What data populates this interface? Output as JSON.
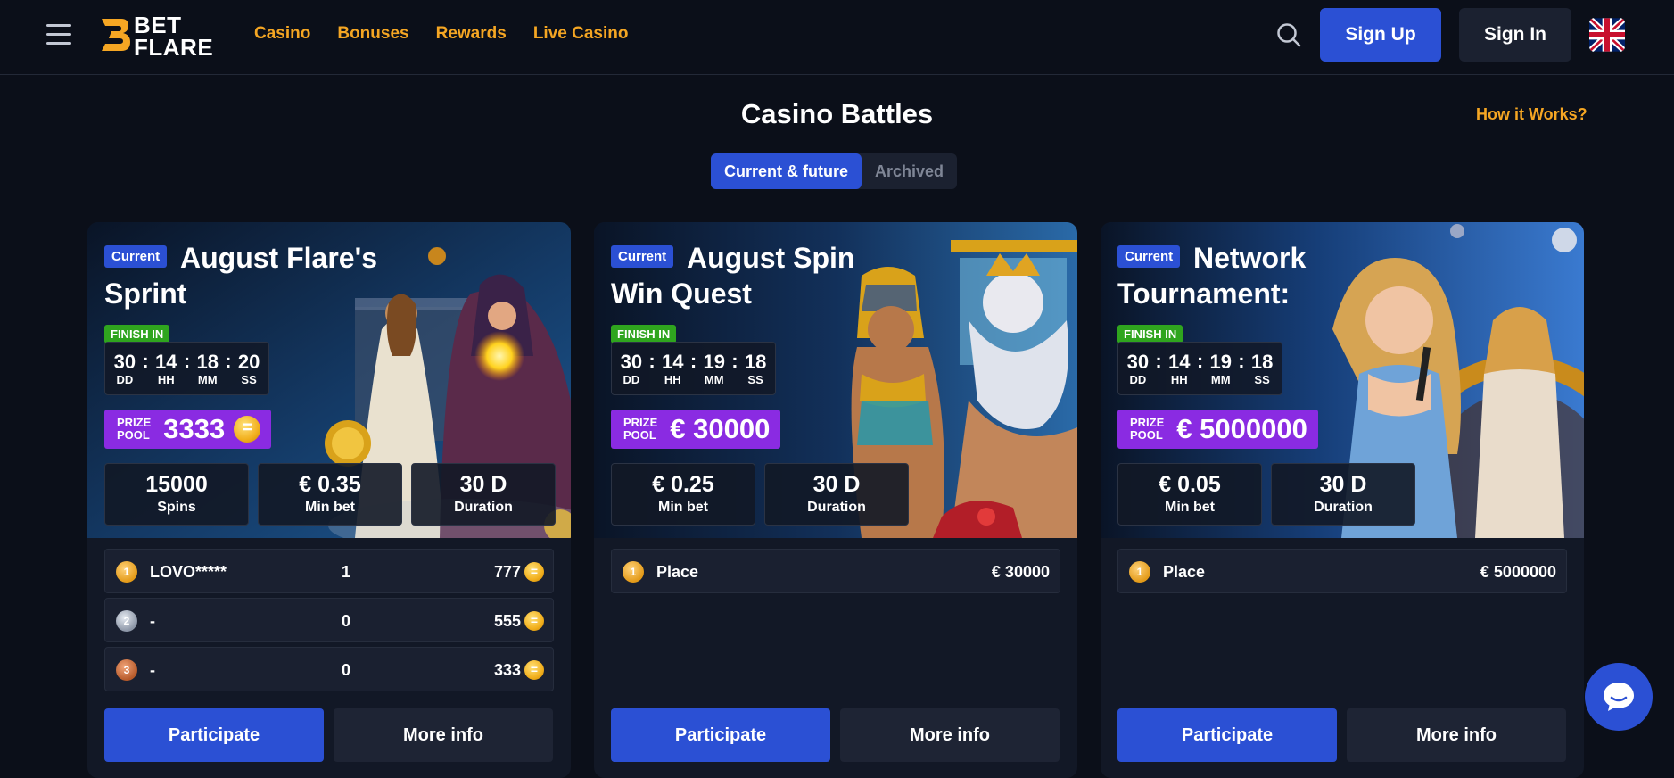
{
  "header": {
    "logo_text_1": "BET",
    "logo_text_2": "FLARE",
    "nav": [
      "Casino",
      "Bonuses",
      "Rewards",
      "Live Casino"
    ],
    "sign_up": "Sign Up",
    "sign_in": "Sign In",
    "language_icon": "uk-flag-icon"
  },
  "page": {
    "title": "Casino Battles",
    "how_it_works": "How it Works?",
    "tabs": [
      {
        "label": "Current & future",
        "active": true
      },
      {
        "label": "Archived",
        "active": false
      }
    ]
  },
  "cards": [
    {
      "badge": "Current",
      "title": "August Flare's Sprint",
      "finish_label": "FINISH IN",
      "timer": [
        {
          "value": "30",
          "unit": "DD"
        },
        {
          "value": "14",
          "unit": "HH"
        },
        {
          "value": "18",
          "unit": "MM"
        },
        {
          "value": "20",
          "unit": "SS"
        }
      ],
      "prize_label_1": "PRIZE",
      "prize_label_2": "POOL",
      "prize_value": "3333",
      "prize_coin": true,
      "stats": [
        {
          "value": "15000",
          "label": "Spins"
        },
        {
          "value": "€ 0.35",
          "label": "Min bet"
        },
        {
          "value": "30 D",
          "label": "Duration"
        }
      ],
      "leaderboard": [
        {
          "rank": "1",
          "name": "LOVO*****",
          "points": "1",
          "amount": "777"
        },
        {
          "rank": "2",
          "name": "-",
          "points": "0",
          "amount": "555"
        },
        {
          "rank": "3",
          "name": "-",
          "points": "0",
          "amount": "333"
        }
      ],
      "participate": "Participate",
      "more_info": "More info"
    },
    {
      "badge": "Current",
      "title": "August Spin Win Quest",
      "finish_label": "FINISH IN",
      "timer": [
        {
          "value": "30",
          "unit": "DD"
        },
        {
          "value": "14",
          "unit": "HH"
        },
        {
          "value": "19",
          "unit": "MM"
        },
        {
          "value": "18",
          "unit": "SS"
        }
      ],
      "prize_label_1": "PRIZE",
      "prize_label_2": "POOL",
      "prize_value": "€ 30000",
      "prize_coin": false,
      "stats": [
        {
          "value": "€ 0.25",
          "label": "Min bet"
        },
        {
          "value": "30 D",
          "label": "Duration"
        }
      ],
      "place": {
        "rank": "1",
        "label": "Place",
        "amount": "€ 30000"
      },
      "participate": "Participate",
      "more_info": "More info"
    },
    {
      "badge": "Current",
      "title": "Network Tournament: Pragmati...",
      "finish_label": "FINISH IN",
      "timer": [
        {
          "value": "30",
          "unit": "DD"
        },
        {
          "value": "14",
          "unit": "HH"
        },
        {
          "value": "19",
          "unit": "MM"
        },
        {
          "value": "18",
          "unit": "SS"
        }
      ],
      "prize_label_1": "PRIZE",
      "prize_label_2": "POOL",
      "prize_value": "€ 5000000",
      "prize_coin": false,
      "stats": [
        {
          "value": "€ 0.05",
          "label": "Min bet"
        },
        {
          "value": "30 D",
          "label": "Duration"
        }
      ],
      "place": {
        "rank": "1",
        "label": "Place",
        "amount": "€ 5000000"
      },
      "participate": "Participate",
      "more_info": "More info"
    }
  ],
  "colors": {
    "accent": "#f5a623",
    "primary": "#2b50d4",
    "background": "#0b0f19",
    "prize": "#8a2be2",
    "finish": "#2fa51e"
  }
}
